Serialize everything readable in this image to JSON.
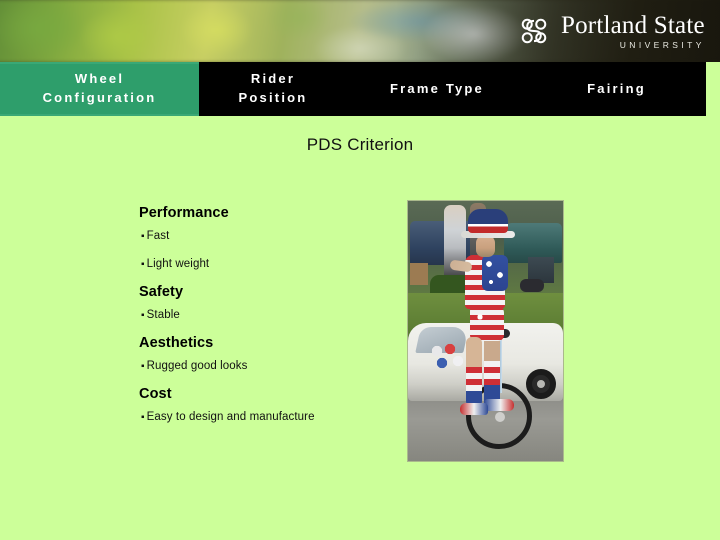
{
  "header": {
    "logo": {
      "mark_name": "psu-knot-logo-icon",
      "name": "Portland State",
      "subtitle": "UNIVERSITY"
    },
    "banner_alt": "blurred campus foliage photo"
  },
  "tabs": [
    {
      "id": "wheel-configuration",
      "line1": "Wheel",
      "line2": "Configuration",
      "active": true,
      "color": "#2e9e6b"
    },
    {
      "id": "rider-position",
      "line1": "Rider",
      "line2": "Position",
      "active": false,
      "color": "#000000"
    },
    {
      "id": "frame-type",
      "line1": "Frame Type",
      "line2": "",
      "active": false,
      "color": "#000000"
    },
    {
      "id": "fairing",
      "line1": "Fairing",
      "line2": "",
      "active": false,
      "color": "#000000"
    }
  ],
  "slide": {
    "title": "PDS Criterion",
    "background_color": "#ccff99"
  },
  "criteria": [
    {
      "heading": "Performance",
      "items": [
        "Fast",
        "Light weight"
      ]
    },
    {
      "heading": "Safety",
      "items": [
        "Stable"
      ]
    },
    {
      "heading": "Aesthetics",
      "items": [
        "Rugged good looks"
      ]
    },
    {
      "heading": "Cost",
      "items": [
        "Easy to design and manufacture"
      ]
    }
  ],
  "bullet_glyph": "▪",
  "photo": {
    "name": "unicycle-rider-photo",
    "description": "Man in stars-and-stripes costume and top hat riding a unicycle past parked cars"
  }
}
